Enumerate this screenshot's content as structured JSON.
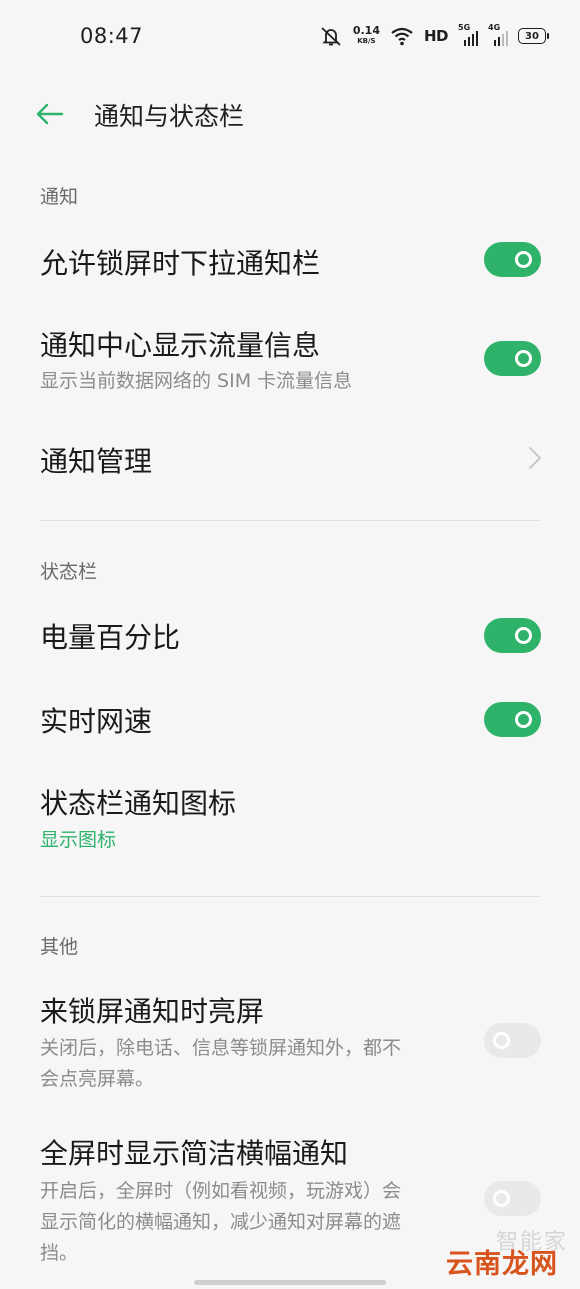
{
  "status_bar": {
    "time": "08:47",
    "speed_value": "0.14",
    "speed_unit": "KB/S",
    "hd_label": "HD",
    "net1_label": "5G",
    "net2_label": "4G",
    "battery": "30"
  },
  "header": {
    "title": "通知与状态栏",
    "back_icon": "arrow-left-icon"
  },
  "sections": {
    "notifications": {
      "label": "通知",
      "allow_pull_down_lock_screen": {
        "title": "允许锁屏时下拉通知栏",
        "enabled": true
      },
      "show_data_usage": {
        "title": "通知中心显示流量信息",
        "subtitle": "显示当前数据网络的 SIM 卡流量信息",
        "enabled": true
      },
      "notification_management": {
        "title": "通知管理"
      }
    },
    "status_bar": {
      "label": "状态栏",
      "battery_percentage": {
        "title": "电量百分比",
        "enabled": true
      },
      "realtime_network_speed": {
        "title": "实时网速",
        "enabled": true
      },
      "status_bar_notification_icons": {
        "title": "状态栏通知图标",
        "value": "显示图标"
      }
    },
    "others": {
      "label": "其他",
      "wake_on_lock_notification": {
        "title": "来锁屏通知时亮屏",
        "subtitle_line1": "关闭后，除电话、信息等锁屏通知外，都不",
        "subtitle_line2": "会点亮屏幕。",
        "enabled": false
      },
      "fullscreen_simple_banner": {
        "title": "全屏时显示简洁横幅通知",
        "subtitle_line1": "开启后，全屏时（例如看视频，玩游戏）会",
        "subtitle_line2": "显示简化的横幅通知，减少通知对屏幕的遮",
        "subtitle_line3": "挡。",
        "enabled": false
      }
    }
  },
  "watermark": {
    "top": "智能家",
    "bottom": "云南龙网"
  },
  "colors": {
    "accent": "#2fb36b",
    "background": "#f6f6f6",
    "toggle_off": "#e9e9e9"
  }
}
